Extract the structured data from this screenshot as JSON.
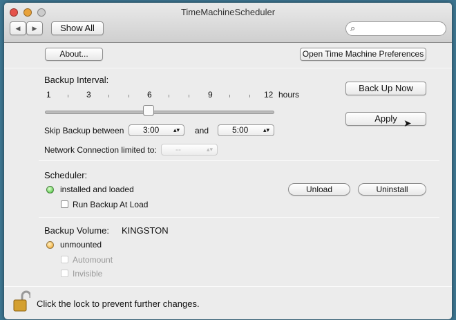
{
  "window": {
    "title": "TimeMachineScheduler"
  },
  "toolbar": {
    "back": "◀",
    "forward": "▶",
    "show_all": "Show All",
    "search_placeholder": ""
  },
  "top": {
    "about": "About...",
    "open_prefs": "Open Time Machine Preferences"
  },
  "interval": {
    "label": "Backup Interval:",
    "ticks": [
      "1",
      "3",
      "6",
      "9",
      "12"
    ],
    "unit": "hours",
    "value": 6,
    "min": 1,
    "max": 12,
    "skip_label": "Skip Backup between",
    "skip_from": "3:00",
    "and": "and",
    "skip_to": "5:00",
    "network_label": "Network Connection limited to:",
    "network_value": "--",
    "back_up_now": "Back Up Now",
    "apply": "Apply"
  },
  "scheduler": {
    "label": "Scheduler:",
    "status": "installed and loaded",
    "status_color": "#3cbf2e",
    "run_at_load": "Run Backup At Load",
    "unload": "Unload",
    "uninstall": "Uninstall"
  },
  "volume": {
    "label": "Backup Volume:",
    "name": "KINGSTON",
    "status": "unmounted",
    "status_color": "#f0a020",
    "automount": "Automount",
    "invisible": "Invisible"
  },
  "footer": {
    "lock_text": "Click the lock to prevent further changes."
  }
}
